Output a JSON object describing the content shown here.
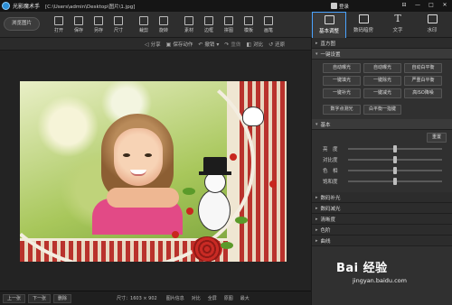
{
  "window": {
    "app_name": "光影魔术手",
    "file_path": "[C:\\Users\\admin\\Desktop\\图片\\1.jpg]",
    "login_label": "登录",
    "controls": [
      "⊟",
      "—",
      "□",
      "✕"
    ]
  },
  "toolbar": {
    "browse_label": "浏览图片",
    "tools": [
      {
        "label": "打开",
        "icon": "folder-icon"
      },
      {
        "label": "保存",
        "icon": "save-icon"
      },
      {
        "label": "另存",
        "icon": "save-as-icon"
      },
      {
        "label": "尺寸",
        "icon": "resize-icon"
      },
      {
        "label": "裁剪",
        "icon": "crop-icon"
      },
      {
        "label": "旋转",
        "icon": "rotate-icon"
      },
      {
        "label": "素材",
        "icon": "material-icon"
      },
      {
        "label": "边框",
        "icon": "border-icon"
      },
      {
        "label": "拼图",
        "icon": "collage-icon"
      },
      {
        "label": "模板",
        "icon": "template-icon"
      },
      {
        "label": "画笔",
        "icon": "brush-icon"
      }
    ],
    "mode_tabs": [
      {
        "label": "基本调整",
        "active": true
      },
      {
        "label": "数码暗房",
        "active": false
      },
      {
        "label": "文字",
        "active": false
      },
      {
        "label": "水印",
        "active": false
      }
    ]
  },
  "subbar": {
    "share": "分享",
    "save_action": "保存动作",
    "undo": "撤销",
    "redo": "重做",
    "compare": "对比",
    "original": "还原"
  },
  "panel": {
    "histogram": "直方图",
    "one_click_title": "一键设置",
    "one_click_buttons": [
      "自动曝光",
      "自动曝光",
      "自动白平衡",
      "一键填光",
      "一键除光",
      "严重白平衡",
      "一键补光",
      "一键减光",
      "高ISO降噪"
    ],
    "extra_buttons": [
      "数字点测光",
      "白平衡一指键"
    ],
    "basic_title": "基本",
    "reset": "重置",
    "sliders": [
      {
        "label": "亮　度",
        "value": 0.5
      },
      {
        "label": "对比度",
        "value": 0.5
      },
      {
        "label": "色　相",
        "value": 0.5
      },
      {
        "label": "饱和度",
        "value": 0.5
      }
    ],
    "sections": [
      "数码补光",
      "数码减光",
      "清晰度",
      "色阶",
      "曲线"
    ]
  },
  "bottombar": {
    "prev": "上一张",
    "next": "下一张",
    "delete": "删除",
    "size_info": "尺寸：1603 × 902",
    "image_info": "图片信息",
    "fit": "对比",
    "fullscreen": "全屏",
    "original_size": "原图",
    "zoom_max": "最大",
    "zoom_pct": "原片 >"
  },
  "watermark": {
    "brand": "Bai  经验",
    "url": "jingyan.baidu.com"
  }
}
